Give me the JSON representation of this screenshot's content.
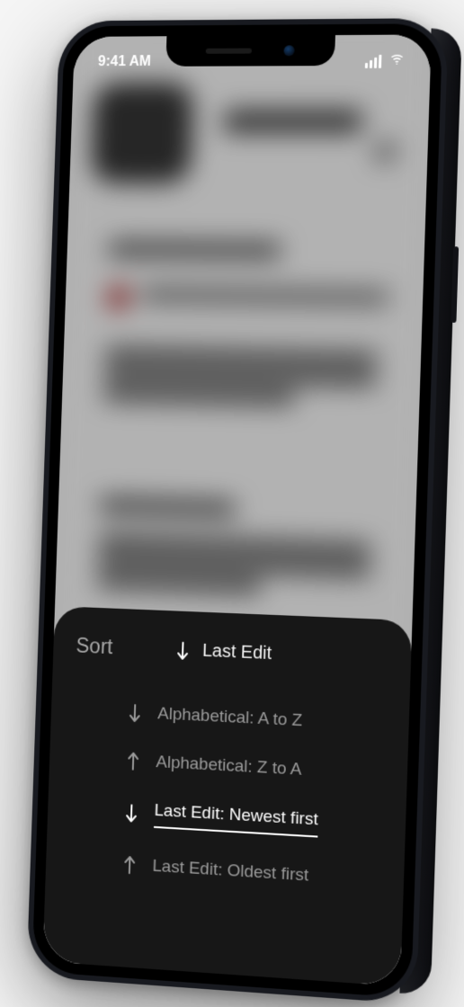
{
  "status": {
    "time": "9:41 AM"
  },
  "sheet": {
    "title": "Sort",
    "current": {
      "label": "Last Edit",
      "direction": "down"
    },
    "options": [
      {
        "label": "Alphabetical: A to Z",
        "direction": "down",
        "selected": false
      },
      {
        "label": "Alphabetical: Z to A",
        "direction": "up",
        "selected": false
      },
      {
        "label": "Last Edit: Newest first",
        "direction": "down",
        "selected": true
      },
      {
        "label": "Last Edit: Oldest first",
        "direction": "up",
        "selected": false
      }
    ]
  }
}
